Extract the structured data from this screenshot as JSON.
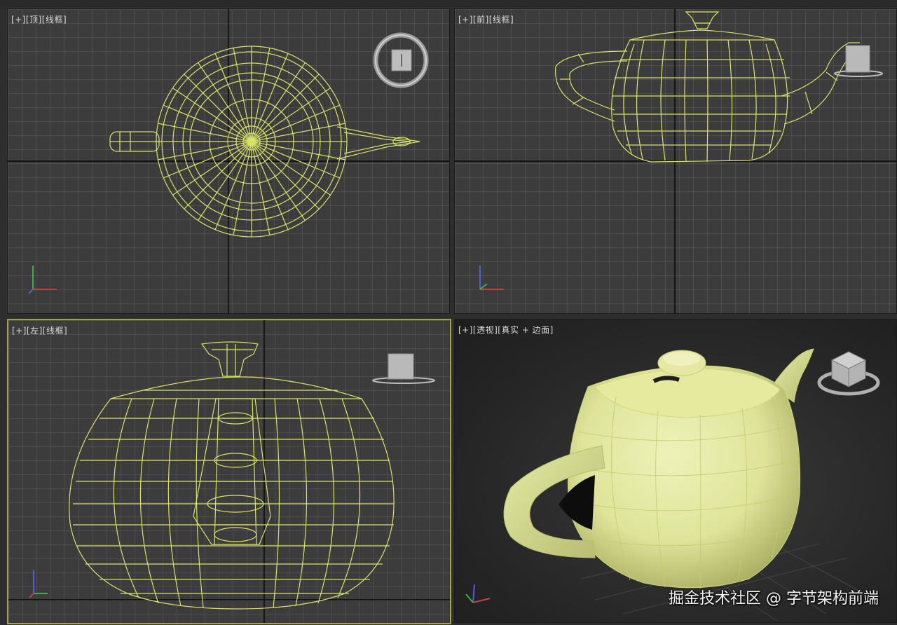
{
  "viewports": {
    "top": {
      "menu": "[+]",
      "view": "[顶]",
      "shading": "[线框]"
    },
    "front": {
      "menu": "[+]",
      "view": "[前]",
      "shading": "[线框]"
    },
    "left": {
      "menu": "[+]",
      "view": "[左]",
      "shading": "[线框]"
    },
    "perspective": {
      "menu": "[+]",
      "view": "[透视]",
      "shading": "[真实 + 边面]"
    }
  },
  "watermark": "掘金技术社区 @ 字节架构前端",
  "colors": {
    "wire": "#d9e36a",
    "solid": "#dfe49a",
    "active_border": "#a6a054",
    "grid": "#4d4d4d",
    "background": "#3c3c3c"
  },
  "icons": {
    "viewcube": "viewcube-icon",
    "axis_gizmo": "axis-tripod-icon"
  }
}
